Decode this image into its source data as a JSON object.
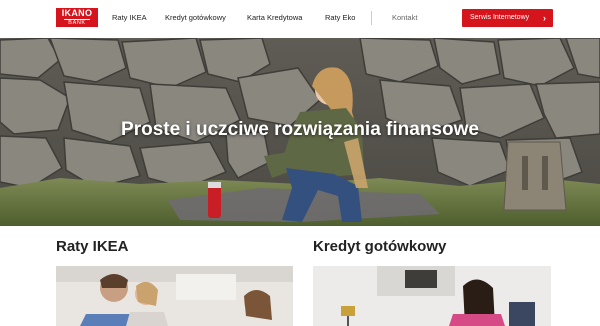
{
  "header": {
    "logo_line1": "IKANO",
    "logo_line2": "BANK",
    "nav": [
      "Raty IKEA",
      "Kredyt gotówkowy",
      "Karta Kredytowa",
      "Raty Eko"
    ],
    "contact": "Kontakt",
    "cta_label": "Serwis Internetowy",
    "cta_icon": "chevron-right-icon"
  },
  "hero": {
    "title": "Proste i uczciwe rozwiązania finansowe"
  },
  "sections": [
    {
      "title": "Raty IKEA"
    },
    {
      "title": "Kredyt gotówkowy"
    }
  ],
  "colors": {
    "brand_red": "#d6141c",
    "text_dark": "#222222"
  }
}
